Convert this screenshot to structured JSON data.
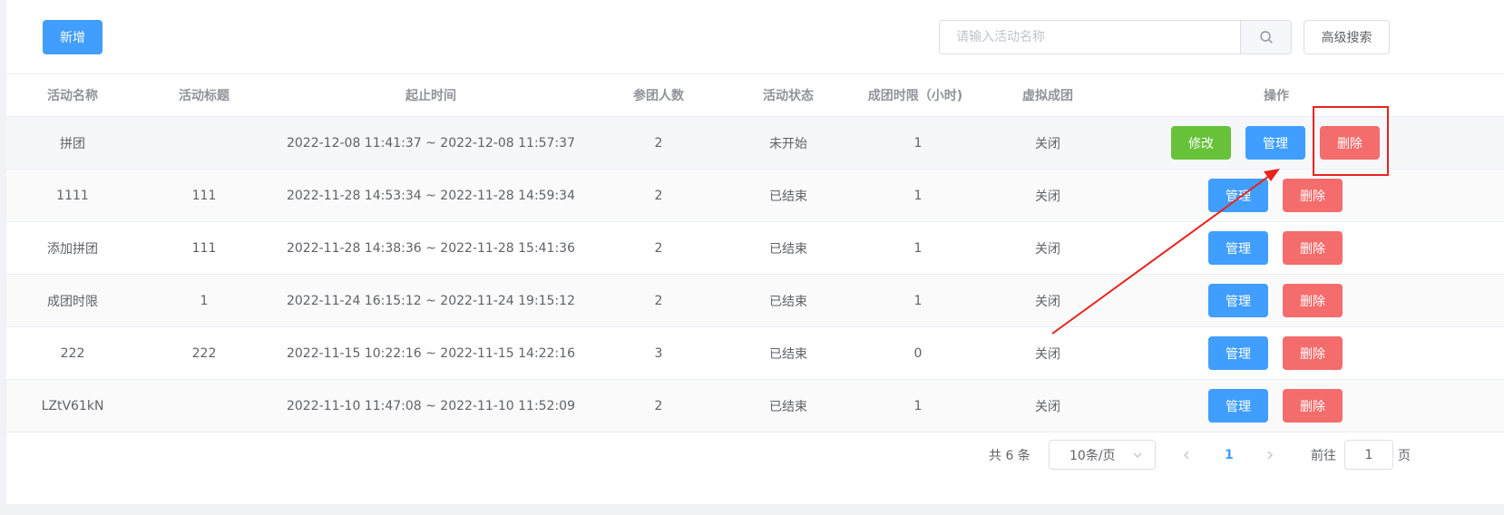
{
  "toolbar": {
    "add_label": "新增",
    "search_placeholder": "请输入活动名称",
    "search_value": "",
    "advanced_search_label": "高级搜索",
    "search_icon": "search-icon"
  },
  "table": {
    "headers": [
      "活动名称",
      "活动标题",
      "起止时间",
      "参团人数",
      "活动状态",
      "成团时限（小时)",
      "虚拟成团",
      "操作"
    ],
    "rows": [
      {
        "name": "拼团",
        "title": "",
        "time": "2022-12-08 11:41:37 ~ 2022-12-08 11:57:37",
        "count": "2",
        "status": "未开始",
        "limit": "1",
        "virtual": "关闭",
        "actions": [
          "修改",
          "管理",
          "删除"
        ]
      },
      {
        "name": "1111",
        "title": "111",
        "time": "2022-11-28 14:53:34 ~ 2022-11-28 14:59:34",
        "count": "2",
        "status": "已结束",
        "limit": "1",
        "virtual": "关闭",
        "actions": [
          "管理",
          "删除"
        ]
      },
      {
        "name": "添加拼团",
        "title": "111",
        "time": "2022-11-28 14:38:36 ~ 2022-11-28 15:41:36",
        "count": "2",
        "status": "已结束",
        "limit": "1",
        "virtual": "关闭",
        "actions": [
          "管理",
          "删除"
        ]
      },
      {
        "name": "成团时限",
        "title": "1",
        "time": "2022-11-24 16:15:12 ~ 2022-11-24 19:15:12",
        "count": "2",
        "status": "已结束",
        "limit": "1",
        "virtual": "关闭",
        "actions": [
          "管理",
          "删除"
        ]
      },
      {
        "name": "222",
        "title": "222",
        "time": "2022-11-15 10:22:16 ~ 2022-11-15 14:22:16",
        "count": "3",
        "status": "已结束",
        "limit": "0",
        "virtual": "关闭",
        "actions": [
          "管理",
          "删除"
        ]
      },
      {
        "name": "LZtV61kN",
        "title": "",
        "time": "2022-11-10 11:47:08 ~ 2022-11-10 11:52:09",
        "count": "2",
        "status": "已结束",
        "limit": "1",
        "virtual": "关闭",
        "actions": [
          "管理",
          "删除"
        ]
      }
    ]
  },
  "pagination": {
    "total_label": "共 6 条",
    "page_size_label": "10条/页",
    "current_page": "1",
    "goto_label": "前往",
    "goto_value": "1",
    "page_suffix": "页"
  },
  "colors": {
    "primary": "#409eff",
    "success": "#67c23a",
    "danger": "#f56c6c",
    "annotation": "#e8231f"
  }
}
